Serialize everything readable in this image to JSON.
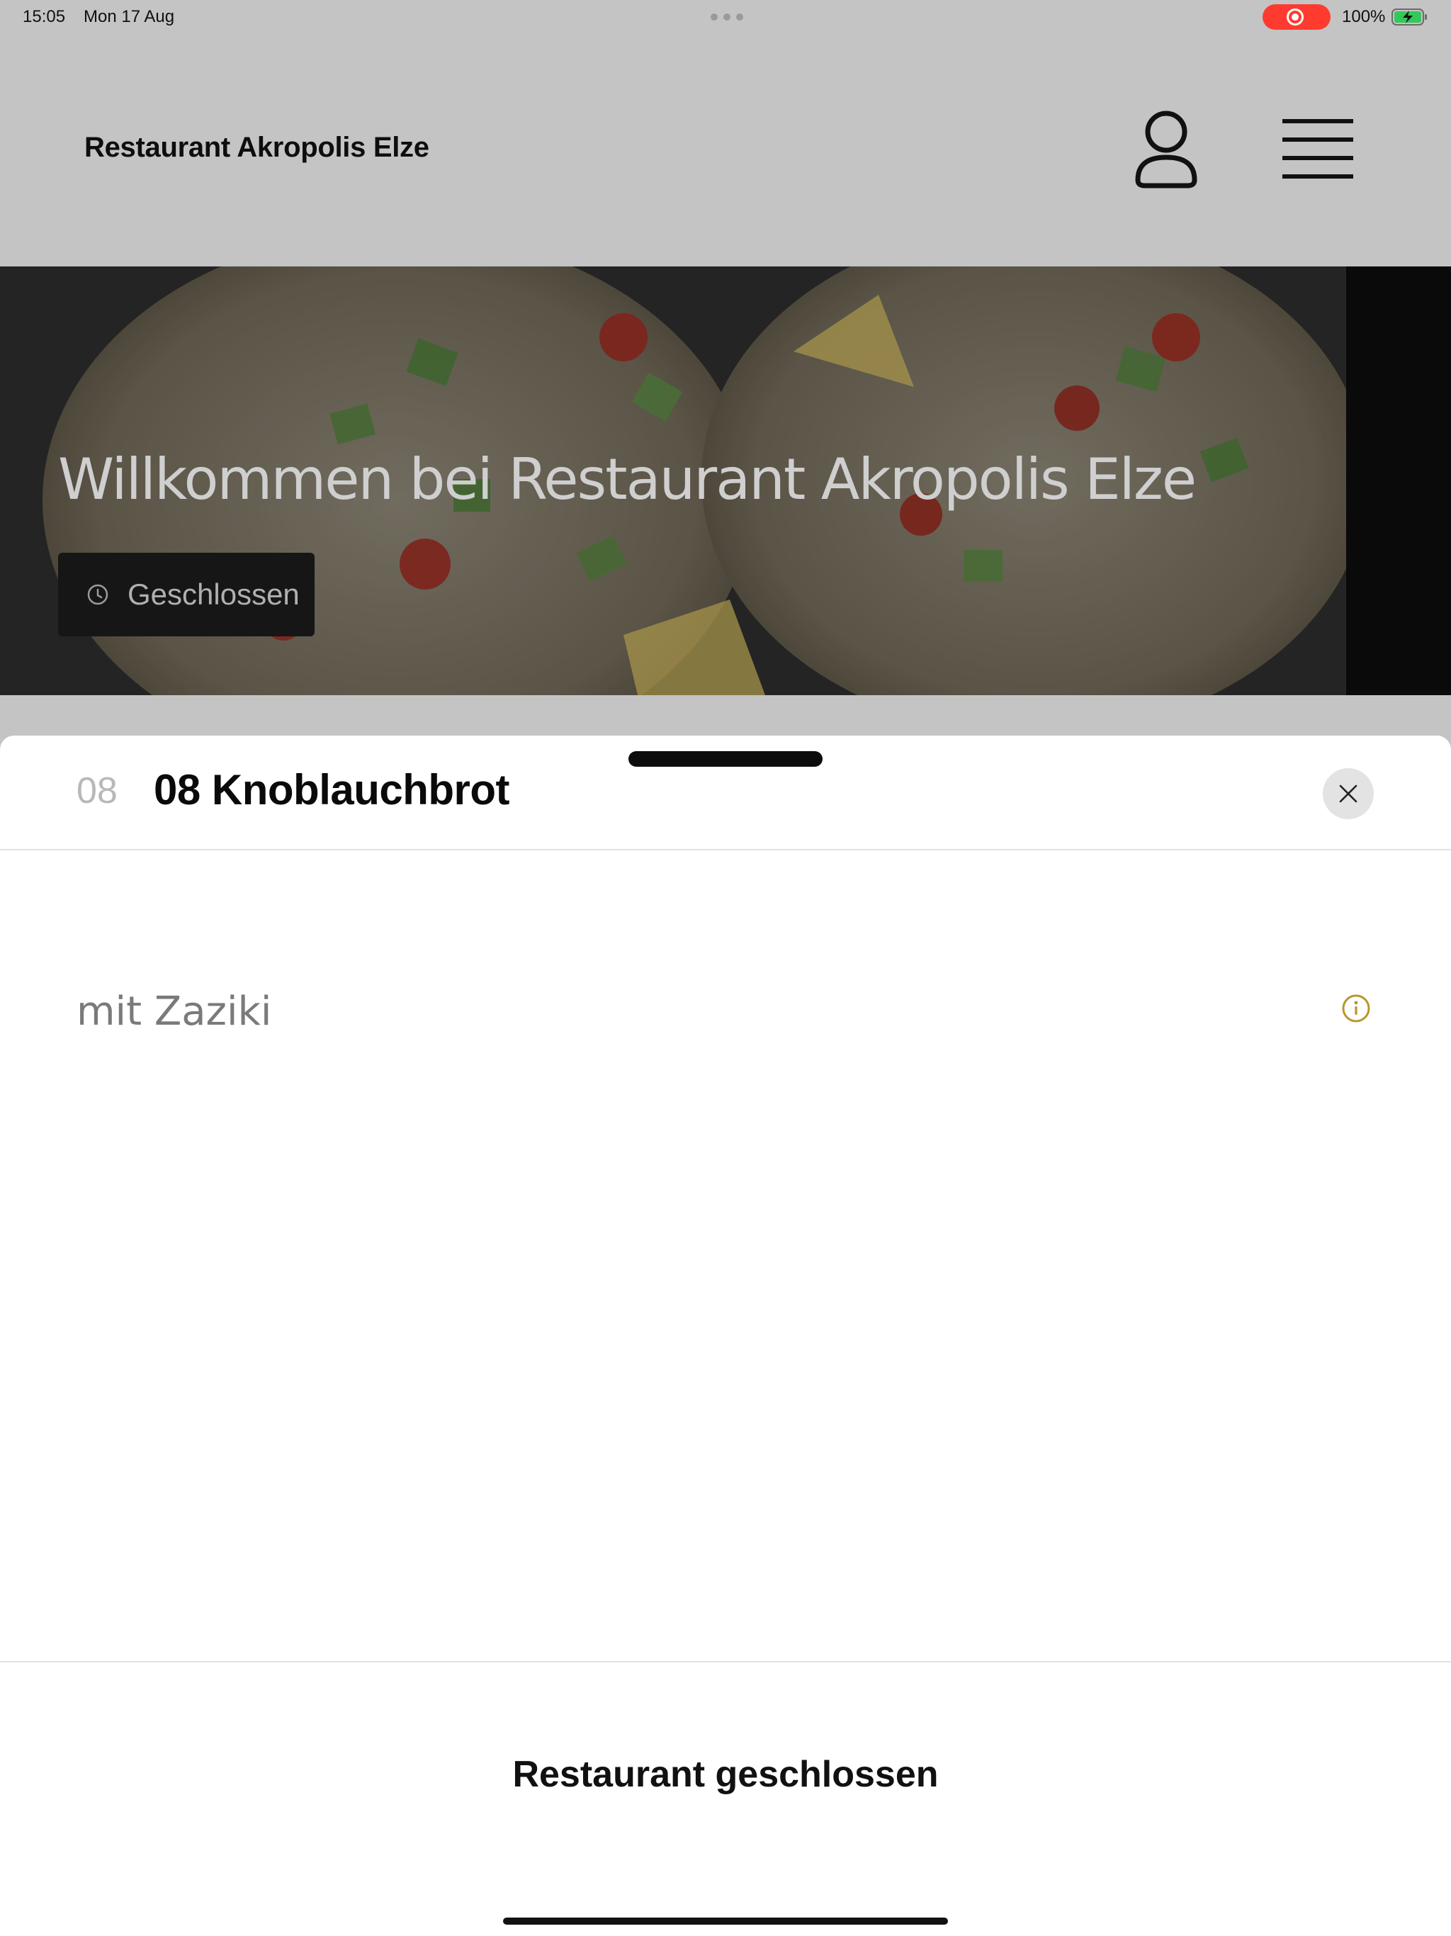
{
  "status_bar": {
    "time": "15:05",
    "date": "Mon 17 Aug",
    "battery": "100%",
    "record_color": "#ff3b30",
    "battery_color": "#34c759"
  },
  "header": {
    "title": "Restaurant Akropolis Elze",
    "account_icon": "user-icon",
    "menu_icon": "hamburger-menu-icon"
  },
  "hero": {
    "heading": "Willkommen bei Restaurant Akropolis Elze",
    "status_icon": "clock-icon",
    "status_label": "Geschlossen"
  },
  "item_sheet": {
    "number": "08",
    "title": "08 Knoblauchbrot",
    "description": "mit Zaziki",
    "info_icon": "info-icon",
    "info_color": "#b8962e",
    "close_icon": "close-icon",
    "footer_notice": "Restaurant geschlossen"
  }
}
